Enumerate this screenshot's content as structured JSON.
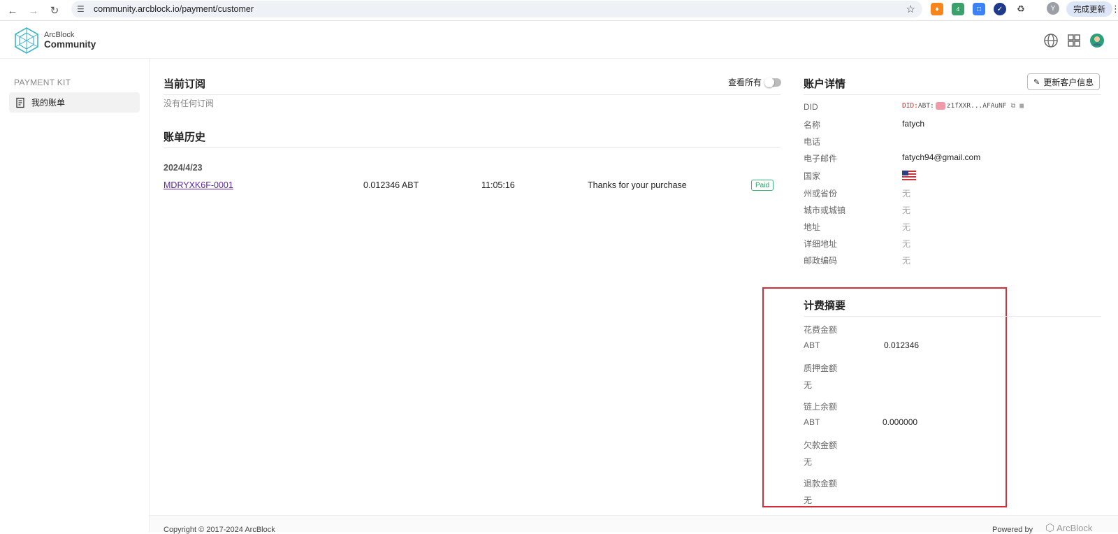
{
  "browser": {
    "url": "community.arcblock.io/payment/customer",
    "profile_initial": "Y",
    "update_button": "完成更新",
    "extension_badge": "4"
  },
  "header": {
    "brand_small": "ArcBlock",
    "brand_big": "Community"
  },
  "sidebar": {
    "section_title": "PAYMENT KIT",
    "items": [
      {
        "label": "我的账单"
      }
    ]
  },
  "subscriptions": {
    "title": "当前订阅",
    "toggle_label": "查看所有",
    "empty_text": "没有任何订阅"
  },
  "billing_history": {
    "title": "账单历史",
    "groups": [
      {
        "date": "2024/4/23",
        "rows": [
          {
            "invoice": "MDRYXK6F-0001",
            "amount": "0.012346 ABT",
            "time": "11:05:16",
            "description": "Thanks for your purchase",
            "status": "Paid"
          }
        ]
      }
    ]
  },
  "account": {
    "title": "账户详情",
    "edit_button": "更新客户信息",
    "did_label": "DID",
    "did_prefix": "DID:",
    "did_chain": "ABT:",
    "did_short": "z1fXXR...AFAuNF",
    "fields": [
      {
        "label": "名称",
        "value": "fatych"
      },
      {
        "label": "电话",
        "value": ""
      },
      {
        "label": "电子邮件",
        "value": "fatych94@gmail.com"
      },
      {
        "label": "国家",
        "value": ""
      },
      {
        "label": "州或省份",
        "value": "无"
      },
      {
        "label": "城市或城镇",
        "value": "无"
      },
      {
        "label": "地址",
        "value": "无"
      },
      {
        "label": "详细地址",
        "value": "无"
      },
      {
        "label": "邮政编码",
        "value": "无"
      }
    ]
  },
  "billing_summary": {
    "title": "计费摘要",
    "items": [
      {
        "label": "花费金额",
        "currency": "ABT",
        "value": "0.012346"
      },
      {
        "label": "质押金额",
        "currency": "无",
        "value": ""
      },
      {
        "label": "链上余额",
        "currency": "ABT",
        "value": "0.000000"
      },
      {
        "label": "欠款金额",
        "currency": "无",
        "value": ""
      },
      {
        "label": "退款金额",
        "currency": "无",
        "value": ""
      }
    ]
  },
  "footer": {
    "copyright": "Copyright © 2017-2024  ArcBlock",
    "powered_by": "Powered by",
    "powered_brand": "ArcBlock"
  },
  "colors": {
    "accent_link": "#5b2b9a",
    "paid_badge": "#2e9e63",
    "highlight_box": "#d32f3a"
  }
}
